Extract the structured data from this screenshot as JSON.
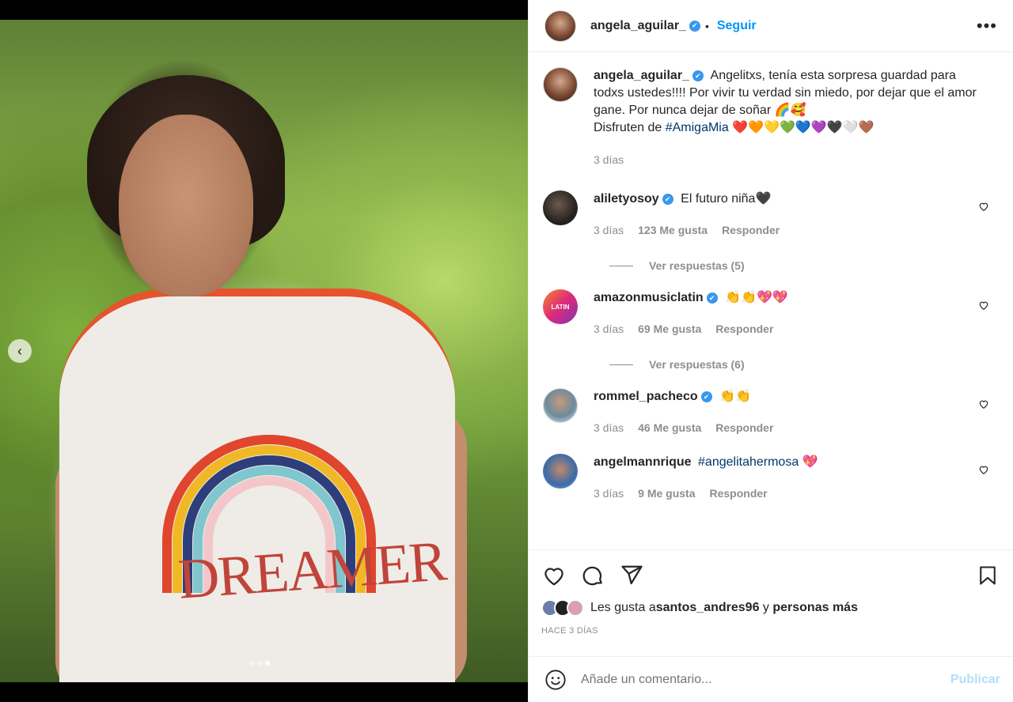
{
  "header": {
    "username": "angela_aguilar_",
    "verified_mark": "✔",
    "separator": "•",
    "follow_label": "Seguir",
    "more_label": "•••"
  },
  "caption": {
    "username": "angela_aguilar_",
    "text_part1": "Angelitxs, tenía esta sorpresa guardad para todxs ustedes!!!! Por vivir tu verdad sin miedo, por dejar que el amor gane. Por nunca dejar de soñar 🌈🥰",
    "text_part2": "Disfruten de ",
    "hashtag": "#AmigaMia",
    "text_part3": " ❤️🧡💛💚💙💜🖤🤍🤎",
    "time": "3 días"
  },
  "comments": [
    {
      "username": "aliletyosoy",
      "text": "El futuro niña🖤",
      "time": "3 días",
      "likes": "123 Me gusta",
      "reply_label": "Responder",
      "view_replies": "Ver respuestas (5)"
    },
    {
      "username": "amazonmusiclatin",
      "text": "👏👏💖💖",
      "time": "3 días",
      "likes": "69 Me gusta",
      "reply_label": "Responder",
      "view_replies": "Ver respuestas (6)",
      "avatar_text": "LATIN"
    },
    {
      "username": "rommel_pacheco",
      "text": "👏👏",
      "time": "3 días",
      "likes": "46 Me gusta",
      "reply_label": "Responder"
    },
    {
      "username": "angelmannrique",
      "hashtag": "#angelitahermosa",
      "text": " 💖",
      "time": "3 días",
      "likes": "9 Me gusta",
      "reply_label": "Responder"
    }
  ],
  "likes": {
    "prefix": "Les gusta a ",
    "user": "santos_andres96",
    "middle": " y ",
    "others": "personas más"
  },
  "posted_ago": "HACE 3 DÍAS",
  "add_comment": {
    "placeholder": "Añade un comentario...",
    "publish_label": "Publicar"
  },
  "photo": {
    "shirt_text": "DREAMER",
    "nav_arrow": "‹",
    "carousel": {
      "count": 3,
      "active": 3
    }
  },
  "colors": {
    "accent": "#0095f6",
    "verified": "#3897f0",
    "hashtag": "#00376b",
    "muted": "#8e8e8e",
    "publish_disabled": "#b2dffc"
  }
}
